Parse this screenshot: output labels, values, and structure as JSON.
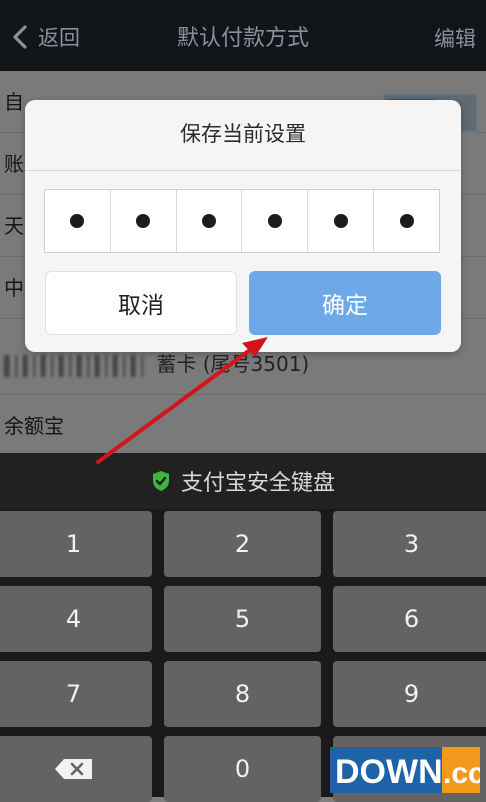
{
  "topbar": {
    "back_label": "返回",
    "title": "默认付款方式",
    "edit_label": "编辑"
  },
  "list": {
    "rows": [
      {
        "label": "自"
      },
      {
        "label": "账"
      },
      {
        "label": "天"
      },
      {
        "label": "中"
      },
      {
        "label": "蓄卡 (尾号3501)"
      },
      {
        "label": "余额宝"
      }
    ]
  },
  "dialog": {
    "title": "保存当前设置",
    "pin_filled_count": 6,
    "cancel_label": "取消",
    "confirm_label": "确定"
  },
  "keyboard": {
    "title": "支付宝安全键盘",
    "keys": [
      "1",
      "2",
      "3",
      "4",
      "5",
      "6",
      "7",
      "8",
      "9",
      "",
      "0",
      ""
    ]
  },
  "watermark": {
    "text": "DOWN.cc"
  },
  "colors": {
    "confirm_button": "#6da9e8",
    "keyboard_bg": "#1a1a1a",
    "key_bg": "#636363",
    "shield": "#3db43a",
    "arrow": "#d3141b"
  }
}
